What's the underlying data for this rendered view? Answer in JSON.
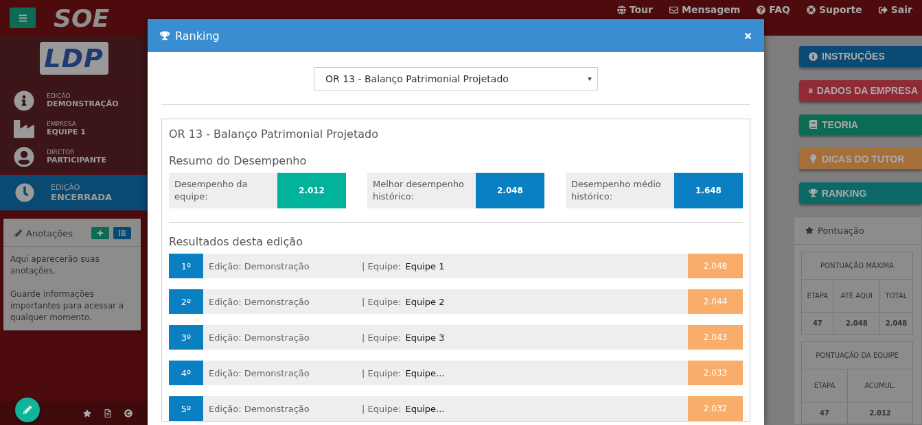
{
  "header": {
    "logo": "SOE",
    "nav": [
      {
        "kind": "globe",
        "label": "Tour"
      },
      {
        "kind": "mail",
        "label": "Mensagem"
      },
      {
        "kind": "question",
        "label": "FAQ"
      },
      {
        "kind": "lifering",
        "label": "Suporte"
      },
      {
        "kind": "signout",
        "label": "Sair"
      }
    ]
  },
  "sidebar": {
    "logo": "LDP",
    "info": [
      {
        "kind": "info",
        "label": "EDIÇÃO",
        "value": "DEMONSTRAÇÃO"
      },
      {
        "kind": "factory",
        "label": "EMPRESA",
        "value": "EQUIPE 1"
      },
      {
        "kind": "avatar",
        "label": "DIRETOR",
        "value": "PARTICIPANTE"
      }
    ],
    "status": {
      "label": "EDIÇÃO",
      "value": "ENCERRADA"
    },
    "notes": {
      "title": "Anotações",
      "paragraphs": [
        "Aqui aparecerão suas anotações.",
        "Guarde informações importantes para acessar a qualquer momento."
      ]
    }
  },
  "modal": {
    "title": "Ranking",
    "select": "OR 13 - Balanço Patrimonial Projetado",
    "card_title": "OR 13 - Balanço Patrimonial Projetado",
    "summary_title": "Resumo do Desempenho",
    "summary": [
      {
        "label": "Desempenho da equipe:",
        "value": "2.012",
        "color": "#00b39a"
      },
      {
        "label": "Melhor desempenho histórico:",
        "value": "2.048",
        "color": "#0a7fc2"
      },
      {
        "label": "Desempenho médio histórico:",
        "value": "1.648",
        "color": "#0a7fc2"
      }
    ],
    "results_title": "Resultados desta edição",
    "results": [
      {
        "rank": "1º",
        "edition": "Edição: Demonstração",
        "team_label": "| Equipe:",
        "team": "Equipe 1",
        "score": "2.048"
      },
      {
        "rank": "2º",
        "edition": "Edição: Demonstração",
        "team_label": "| Equipe:",
        "team": "Equipe 2",
        "score": "2.044"
      },
      {
        "rank": "3º",
        "edition": "Edição: Demonstração",
        "team_label": "| Equipe:",
        "team": "Equipe 3",
        "score": "2.043"
      },
      {
        "rank": "4º",
        "edition": "Edição:  Demonstração",
        "team_label": "| Equipe:",
        "team": "Equipe...",
        "score": "2.033"
      },
      {
        "rank": "5º",
        "edition": "Edição: Demonstração",
        "team_label": "| Equipe:",
        "team": "Equipe...",
        "score": "2.032"
      }
    ]
  },
  "right": {
    "buttons": [
      {
        "kind": "info",
        "label": "INSTRUÇÕES",
        "color": "#0b4a74"
      },
      {
        "kind": "building",
        "label": "DADOS DA EMPRESA",
        "color": "#8e2b35"
      },
      {
        "kind": "book",
        "label": "TEORIA",
        "color": "#0b6b55"
      },
      {
        "kind": "bulb",
        "label": "DICAS DO TUTOR",
        "color": "#a56f3a"
      },
      {
        "kind": "trophy",
        "label": "RANKING",
        "color": "#0b6a68"
      }
    ],
    "score": {
      "title": "Pontuação",
      "tables": [
        {
          "heading": "PONTUAÇÃO MÁXIMA",
          "columns": [
            "ETAPA",
            "ATÉ AQUI",
            "TOTAL"
          ],
          "values": [
            "47",
            "2.048",
            "2.048"
          ]
        },
        {
          "heading": "PONTUAÇÃO DA EQUIPE",
          "columns": [
            "ETAPA",
            "ACUMUL."
          ],
          "values": [
            "47",
            "2.012"
          ]
        }
      ]
    }
  }
}
